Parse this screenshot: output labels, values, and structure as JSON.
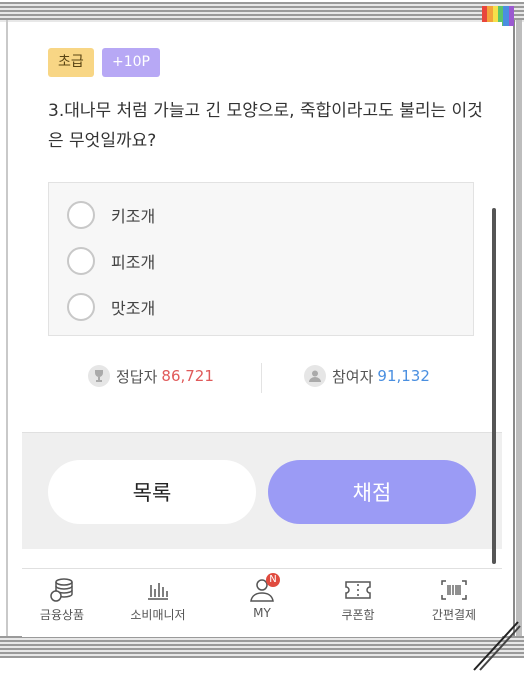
{
  "quiz": {
    "level_badge": "초급",
    "point_badge": "+10P",
    "question": "3.대나무 처럼 가늘고 긴 모양으로, 죽합이라고도 불리는 이것은 무엇일까요?",
    "options": [
      "키조개",
      "피조개",
      "맛조개"
    ]
  },
  "stats": {
    "correct_label": "정답자",
    "correct_count": "86,721",
    "participants_label": "참여자",
    "participants_count": "91,132"
  },
  "buttons": {
    "list": "목록",
    "grade": "채점"
  },
  "tabbar": {
    "items": [
      {
        "label": "금융상품",
        "icon": "coins-icon"
      },
      {
        "label": "소비매니저",
        "icon": "bar-chart-icon"
      },
      {
        "label": "MY",
        "icon": "user-icon",
        "badge": "N"
      },
      {
        "label": "쿠폰함",
        "icon": "ticket-icon"
      },
      {
        "label": "간편결제",
        "icon": "barcode-icon"
      }
    ]
  },
  "colors": {
    "level_badge_bg": "#f8d685",
    "point_badge_bg": "#b7a8f5",
    "grade_button": "#9b9bf5",
    "correct_count": "#e05a5a",
    "participants_count": "#4a8fe0"
  }
}
